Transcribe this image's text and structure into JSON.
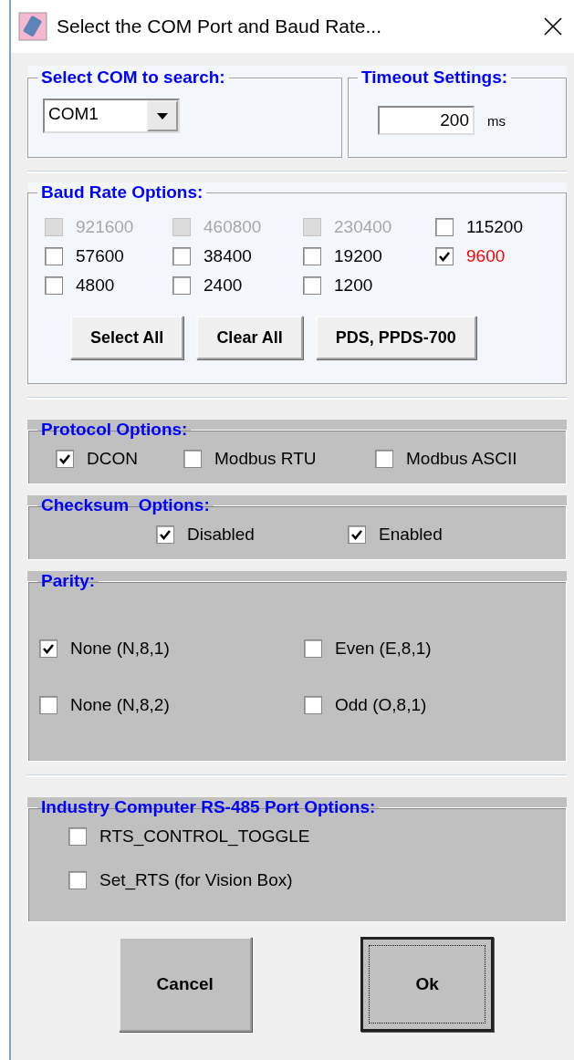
{
  "window": {
    "title": "Select the COM Port and Baud Rate..."
  },
  "com_group": {
    "title": "Select COM to search:",
    "port_select": {
      "value": "COM1"
    }
  },
  "timeout_group": {
    "title": "Timeout Settings:",
    "value": "200",
    "unit": "ms"
  },
  "baud_group": {
    "title": "Baud Rate Options:",
    "options": [
      {
        "label": "921600",
        "checked": false,
        "disabled": true,
        "highlighted": false
      },
      {
        "label": "460800",
        "checked": false,
        "disabled": true,
        "highlighted": false
      },
      {
        "label": "230400",
        "checked": false,
        "disabled": true,
        "highlighted": false
      },
      {
        "label": "115200",
        "checked": false,
        "disabled": false,
        "highlighted": false
      },
      {
        "label": "57600",
        "checked": false,
        "disabled": false,
        "highlighted": false
      },
      {
        "label": "38400",
        "checked": false,
        "disabled": false,
        "highlighted": false
      },
      {
        "label": "19200",
        "checked": false,
        "disabled": false,
        "highlighted": false
      },
      {
        "label": "9600",
        "checked": true,
        "disabled": false,
        "highlighted": true
      },
      {
        "label": "4800",
        "checked": false,
        "disabled": false,
        "highlighted": false
      },
      {
        "label": "2400",
        "checked": false,
        "disabled": false,
        "highlighted": false
      },
      {
        "label": "1200",
        "checked": false,
        "disabled": false,
        "highlighted": false
      }
    ],
    "buttons": [
      "Select All",
      "Clear All",
      "PDS, PPDS-700"
    ]
  },
  "protocol_group": {
    "title": "Protocol Options:",
    "options": [
      {
        "label": "DCON",
        "checked": true
      },
      {
        "label": "Modbus RTU",
        "checked": false
      },
      {
        "label": "Modbus ASCII",
        "checked": false
      }
    ]
  },
  "checksum_group": {
    "title": "Checksum  Options:",
    "options": [
      {
        "label": "Disabled",
        "checked": true
      },
      {
        "label": "Enabled",
        "checked": true
      }
    ]
  },
  "parity_group": {
    "title": "Parity:",
    "options": [
      {
        "label": "None (N,8,1)",
        "checked": true
      },
      {
        "label": "Even (E,8,1)",
        "checked": false
      },
      {
        "label": "None (N,8,2)",
        "checked": false
      },
      {
        "label": "Odd (O,8,1)",
        "checked": false
      }
    ]
  },
  "rs485_group": {
    "title": "Industry Computer RS-485 Port Options:",
    "options": [
      {
        "label": "RTS_CONTROL_TOGGLE",
        "checked": false
      },
      {
        "label": "Set_RTS (for Vision Box)",
        "checked": false
      }
    ]
  },
  "buttons": [
    {
      "label": "Cancel",
      "focused": false
    },
    {
      "label": "Ok",
      "focused": true
    }
  ]
}
